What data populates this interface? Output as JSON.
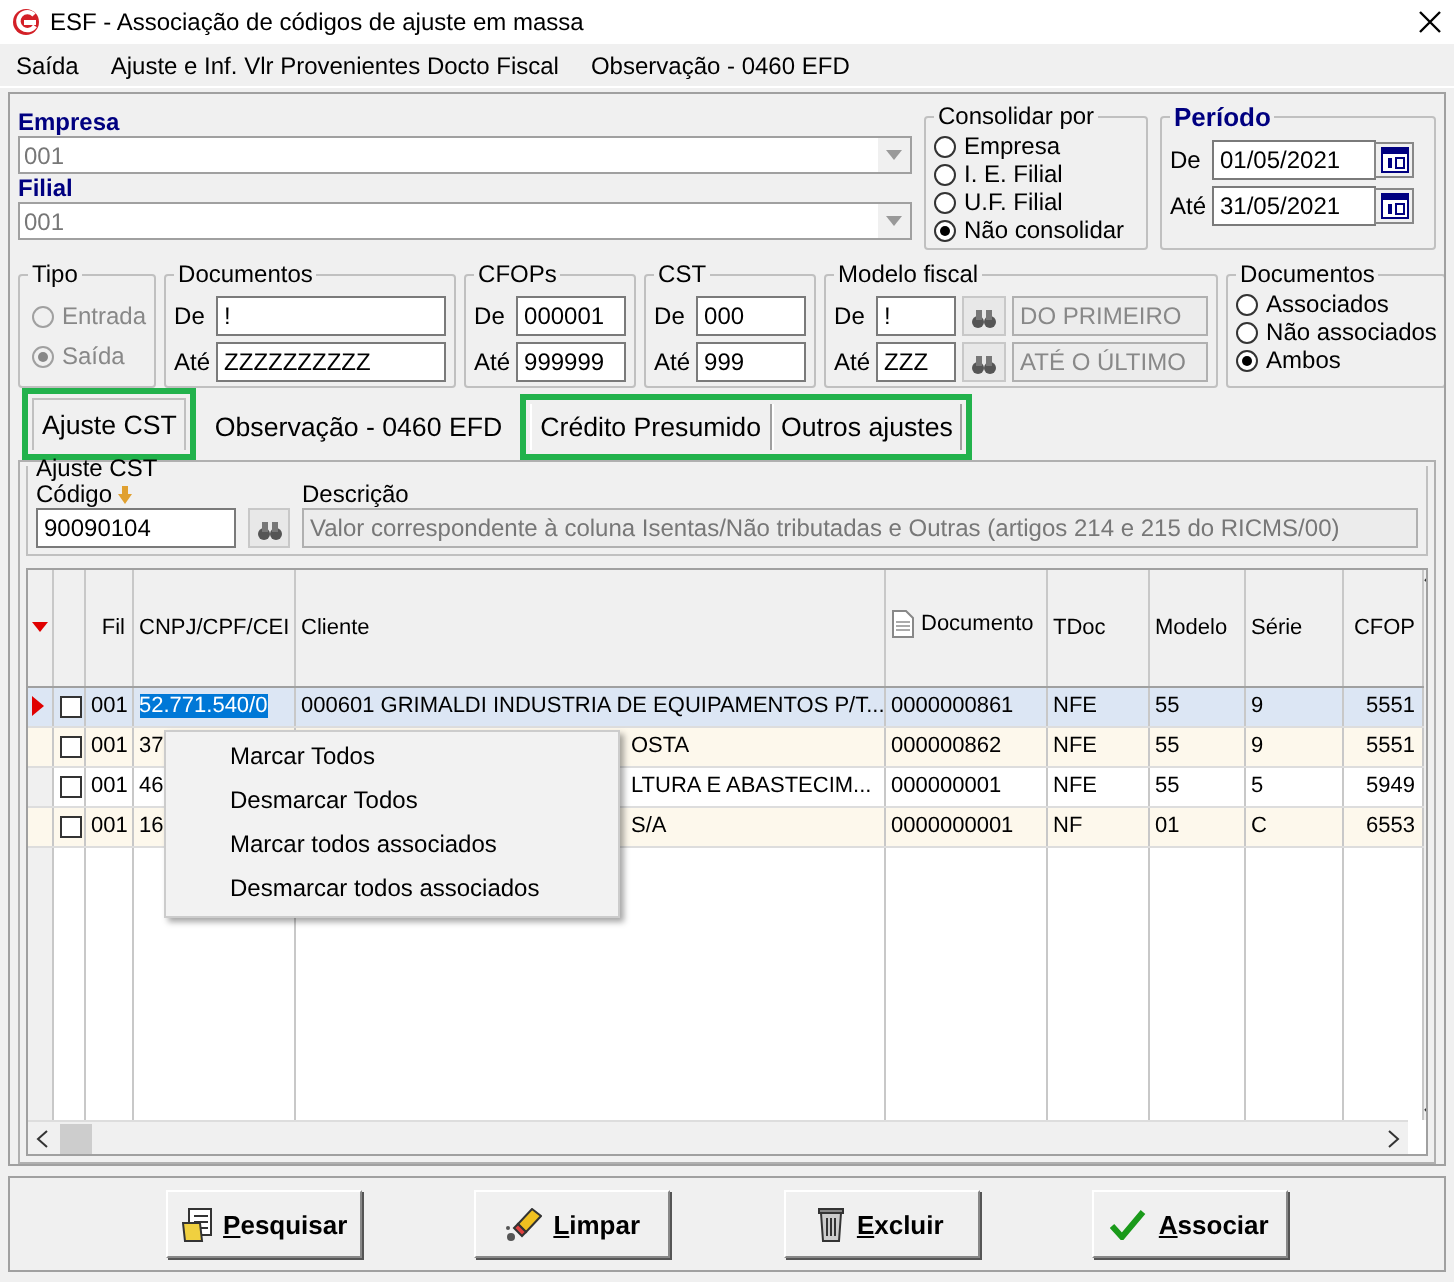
{
  "window": {
    "title": "ESF - Associação de códigos de ajuste em massa"
  },
  "menu": [
    "Saída",
    "Ajuste e Inf. Vlr Provenientes Docto Fiscal",
    "Observação - 0460 EFD"
  ],
  "empresa": {
    "label": "Empresa",
    "value": "001"
  },
  "filial": {
    "label": "Filial",
    "value": "001"
  },
  "consolidar": {
    "title": "Consolidar por",
    "options": [
      {
        "label": "Empresa",
        "selected": false
      },
      {
        "label": "I. E. Filial",
        "selected": false
      },
      {
        "label": "U.F. Filial",
        "selected": false
      },
      {
        "label": "Não consolidar",
        "selected": true
      }
    ]
  },
  "periodo": {
    "title": "Período",
    "from": {
      "label": "De",
      "value": "01/05/2021"
    },
    "to": {
      "label": "Até",
      "value": "31/05/2021"
    }
  },
  "tipo": {
    "title": "Tipo",
    "disabled": true,
    "options": [
      {
        "label": "Entrada",
        "selected": false
      },
      {
        "label": "Saída",
        "selected": true
      }
    ]
  },
  "ranges": [
    {
      "title": "Documentos",
      "from": {
        "label": "De",
        "value": "!"
      },
      "to": {
        "label": "Até",
        "value": "ZZZZZZZZZZ"
      }
    },
    {
      "title": "CFOPs",
      "from": {
        "label": "De",
        "value": "000001"
      },
      "to": {
        "label": "Até",
        "value": "999999"
      }
    },
    {
      "title": "CST",
      "from": {
        "label": "De",
        "value": "000"
      },
      "to": {
        "label": "Até",
        "value": "999"
      }
    }
  ],
  "modelo_fiscal": {
    "title": "Modelo fiscal",
    "from": {
      "label": "De",
      "value": "!",
      "description": "DO PRIMEIRO"
    },
    "to": {
      "label": "Até",
      "value": "ZZZ",
      "description": "ATÉ O ÚLTIMO"
    }
  },
  "documentos_filter": {
    "title": "Documentos",
    "options": [
      {
        "label": "Associados",
        "selected": false
      },
      {
        "label": "Não associados",
        "selected": false
      },
      {
        "label": "Ambos",
        "selected": true
      }
    ]
  },
  "tab_groups": [
    {
      "highlighted": true,
      "tabs": [
        {
          "label": "Ajuste CST",
          "selected": true
        }
      ]
    },
    {
      "highlighted": false,
      "tabs": [
        {
          "label": "Observação - 0460 EFD",
          "selected": false
        }
      ]
    },
    {
      "highlighted": true,
      "tabs": [
        {
          "label": "Crédito Presumido",
          "selected": false
        },
        {
          "label": "Outros ajustes",
          "selected": false
        }
      ]
    }
  ],
  "ajuste_cst": {
    "title": "Ajuste CST",
    "codigo_label": "Código",
    "codigo": "90090104",
    "descricao_label": "Descrição",
    "descricao": "Valor correspondente à coluna Isentas/Não tributadas e Outras (artigos 214 e 215 do RICMS/00)"
  },
  "table": {
    "columns": [
      "Fil",
      "CNPJ/CPF/CEI",
      "Cliente",
      "Documento",
      "TDoc",
      "Modelo",
      "Série",
      "CFOP"
    ],
    "rows": [
      {
        "selected": true,
        "checked": false,
        "cells": [
          "001",
          "52.771.540/0",
          "000601 GRIMALDI INDUSTRIA DE EQUIPAMENTOS P/T...",
          "0000000861",
          "NFE",
          "55",
          "9",
          "5551"
        ]
      },
      {
        "selected": false,
        "checked": false,
        "cells": [
          "001",
          "37",
          "OSTA",
          "000000862",
          "NFE",
          "55",
          "9",
          "5551"
        ]
      },
      {
        "selected": false,
        "checked": false,
        "cells": [
          "001",
          "46",
          "LTURA E ABASTECIM...",
          "000000001",
          "NFE",
          "55",
          "5",
          "5949"
        ]
      },
      {
        "selected": false,
        "checked": false,
        "cells": [
          "001",
          "16",
          "S/A",
          "0000000001",
          "NF",
          "01",
          "C",
          "6553"
        ]
      }
    ]
  },
  "context_menu": {
    "items": [
      "Marcar Todos",
      "Desmarcar Todos",
      "Marcar todos associados",
      "Desmarcar todos associados"
    ]
  },
  "buttons": [
    {
      "label": "Pesquisar",
      "kind": "search"
    },
    {
      "label": "Limpar",
      "kind": "clear"
    },
    {
      "label": "Excluir",
      "kind": "delete"
    },
    {
      "label": "Associar",
      "kind": "confirm"
    }
  ]
}
